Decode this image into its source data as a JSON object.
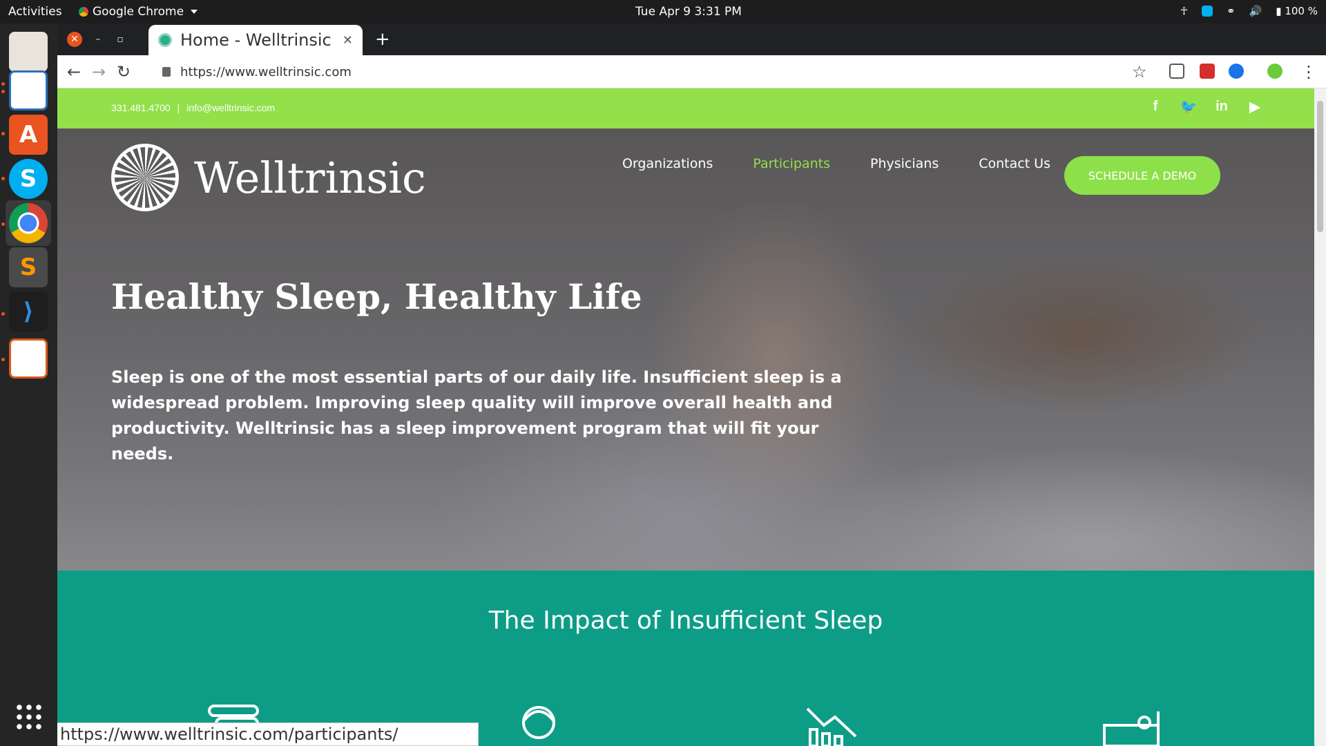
{
  "os": {
    "activities": "Activities",
    "app_name": "Google Chrome",
    "clock": "Tue Apr 9   3:31 PM",
    "battery": "100 %"
  },
  "browser": {
    "tab_title": "Home - Welltrinsic",
    "url": "https://www.welltrinsic.com",
    "hover_url": "https://www.welltrinsic.com/participants/"
  },
  "site": {
    "phone": "331.481.4700",
    "email": "info@welltrinsic.com",
    "separator": "|",
    "logo_text": "Welltrinsic",
    "nav": [
      "Organizations",
      "Participants",
      "Physicians",
      "Contact Us"
    ],
    "cta": "SCHEDULE A DEMO",
    "headline": "Healthy Sleep, Healthy Life",
    "lead": "Sleep is one of the most essential parts of our daily life. Insufficient sleep is a widespread problem. Improving sleep quality will improve overall health and productivity. Welltrinsic has a sleep improvement program that will fit your needs.",
    "impact_title": "The Impact of Insufficient Sleep",
    "social": [
      "facebook-icon",
      "twitter-icon",
      "linkedin-icon",
      "youtube-icon"
    ]
  },
  "colors": {
    "brand_green": "#92e04a",
    "teal": "#0d9d87"
  }
}
